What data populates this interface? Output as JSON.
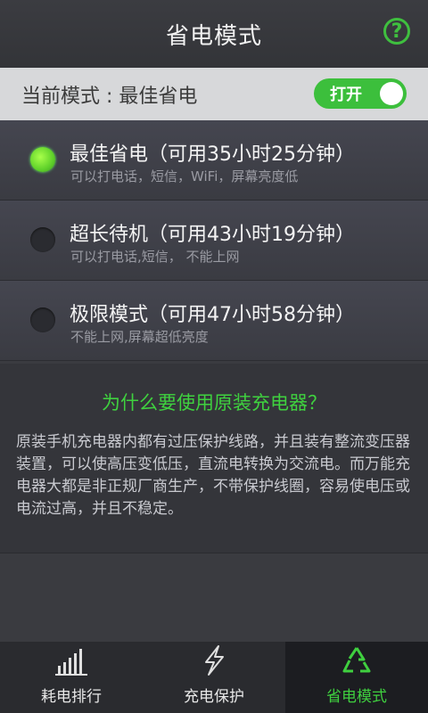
{
  "header": {
    "title": "省电模式",
    "help": "?"
  },
  "mode_bar": {
    "label": "当前模式 : 最佳省电",
    "toggle": "打开"
  },
  "options": [
    {
      "title": "最佳省电（可用35小时25分钟）",
      "subtitle": "可以打电话，短信，WiFi，屏幕亮度低",
      "selected": true
    },
    {
      "title": "超长待机（可用43小时19分钟）",
      "subtitle": "可以打电话,短信， 不能上网",
      "selected": false
    },
    {
      "title": "极限模式（可用47小时58分钟）",
      "subtitle": "不能上网,屏幕超低亮度",
      "selected": false
    }
  ],
  "info": {
    "question": "为什么要使用原装充电器？",
    "text": "原装手机充电器内都有过压保护线路，并且装有整流变压器装置，可以使高压变低压，直流电转换为交流电。而万能充电器大都是非正规厂商生产，不带保护线圈，容易使电压或电流过高，并且不稳定。"
  },
  "tabs": [
    {
      "label": "耗电排行",
      "icon": "bar-chart-icon"
    },
    {
      "label": "充电保护",
      "icon": "lightning-icon"
    },
    {
      "label": "省电模式",
      "icon": "recycle-icon"
    }
  ],
  "colors": {
    "accent": "#3fbf3f",
    "background": "#3a3b40"
  }
}
